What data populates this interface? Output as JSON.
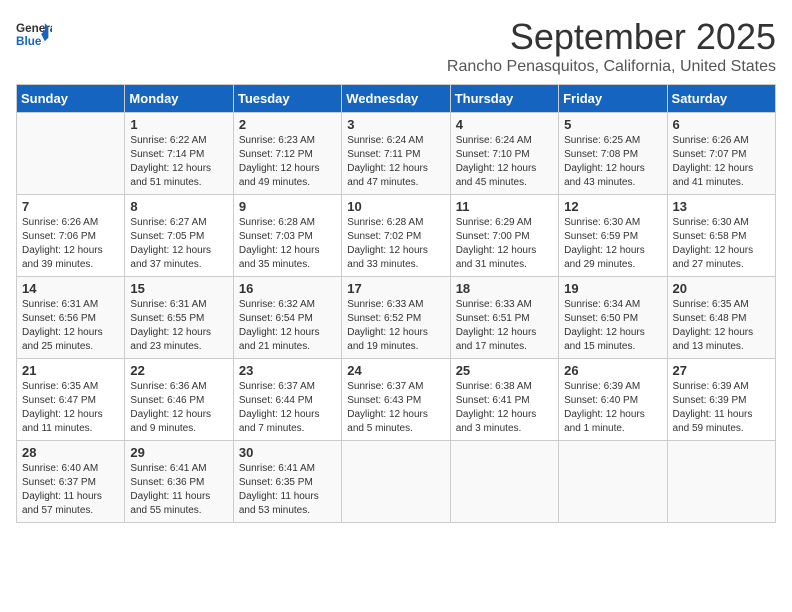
{
  "logo": {
    "line1": "General",
    "line2": "Blue"
  },
  "title": "September 2025",
  "subtitle": "Rancho Penasquitos, California, United States",
  "weekdays": [
    "Sunday",
    "Monday",
    "Tuesday",
    "Wednesday",
    "Thursday",
    "Friday",
    "Saturday"
  ],
  "weeks": [
    [
      {
        "day": "",
        "info": ""
      },
      {
        "day": "1",
        "info": "Sunrise: 6:22 AM\nSunset: 7:14 PM\nDaylight: 12 hours\nand 51 minutes."
      },
      {
        "day": "2",
        "info": "Sunrise: 6:23 AM\nSunset: 7:12 PM\nDaylight: 12 hours\nand 49 minutes."
      },
      {
        "day": "3",
        "info": "Sunrise: 6:24 AM\nSunset: 7:11 PM\nDaylight: 12 hours\nand 47 minutes."
      },
      {
        "day": "4",
        "info": "Sunrise: 6:24 AM\nSunset: 7:10 PM\nDaylight: 12 hours\nand 45 minutes."
      },
      {
        "day": "5",
        "info": "Sunrise: 6:25 AM\nSunset: 7:08 PM\nDaylight: 12 hours\nand 43 minutes."
      },
      {
        "day": "6",
        "info": "Sunrise: 6:26 AM\nSunset: 7:07 PM\nDaylight: 12 hours\nand 41 minutes."
      }
    ],
    [
      {
        "day": "7",
        "info": "Sunrise: 6:26 AM\nSunset: 7:06 PM\nDaylight: 12 hours\nand 39 minutes."
      },
      {
        "day": "8",
        "info": "Sunrise: 6:27 AM\nSunset: 7:05 PM\nDaylight: 12 hours\nand 37 minutes."
      },
      {
        "day": "9",
        "info": "Sunrise: 6:28 AM\nSunset: 7:03 PM\nDaylight: 12 hours\nand 35 minutes."
      },
      {
        "day": "10",
        "info": "Sunrise: 6:28 AM\nSunset: 7:02 PM\nDaylight: 12 hours\nand 33 minutes."
      },
      {
        "day": "11",
        "info": "Sunrise: 6:29 AM\nSunset: 7:00 PM\nDaylight: 12 hours\nand 31 minutes."
      },
      {
        "day": "12",
        "info": "Sunrise: 6:30 AM\nSunset: 6:59 PM\nDaylight: 12 hours\nand 29 minutes."
      },
      {
        "day": "13",
        "info": "Sunrise: 6:30 AM\nSunset: 6:58 PM\nDaylight: 12 hours\nand 27 minutes."
      }
    ],
    [
      {
        "day": "14",
        "info": "Sunrise: 6:31 AM\nSunset: 6:56 PM\nDaylight: 12 hours\nand 25 minutes."
      },
      {
        "day": "15",
        "info": "Sunrise: 6:31 AM\nSunset: 6:55 PM\nDaylight: 12 hours\nand 23 minutes."
      },
      {
        "day": "16",
        "info": "Sunrise: 6:32 AM\nSunset: 6:54 PM\nDaylight: 12 hours\nand 21 minutes."
      },
      {
        "day": "17",
        "info": "Sunrise: 6:33 AM\nSunset: 6:52 PM\nDaylight: 12 hours\nand 19 minutes."
      },
      {
        "day": "18",
        "info": "Sunrise: 6:33 AM\nSunset: 6:51 PM\nDaylight: 12 hours\nand 17 minutes."
      },
      {
        "day": "19",
        "info": "Sunrise: 6:34 AM\nSunset: 6:50 PM\nDaylight: 12 hours\nand 15 minutes."
      },
      {
        "day": "20",
        "info": "Sunrise: 6:35 AM\nSunset: 6:48 PM\nDaylight: 12 hours\nand 13 minutes."
      }
    ],
    [
      {
        "day": "21",
        "info": "Sunrise: 6:35 AM\nSunset: 6:47 PM\nDaylight: 12 hours\nand 11 minutes."
      },
      {
        "day": "22",
        "info": "Sunrise: 6:36 AM\nSunset: 6:46 PM\nDaylight: 12 hours\nand 9 minutes."
      },
      {
        "day": "23",
        "info": "Sunrise: 6:37 AM\nSunset: 6:44 PM\nDaylight: 12 hours\nand 7 minutes."
      },
      {
        "day": "24",
        "info": "Sunrise: 6:37 AM\nSunset: 6:43 PM\nDaylight: 12 hours\nand 5 minutes."
      },
      {
        "day": "25",
        "info": "Sunrise: 6:38 AM\nSunset: 6:41 PM\nDaylight: 12 hours\nand 3 minutes."
      },
      {
        "day": "26",
        "info": "Sunrise: 6:39 AM\nSunset: 6:40 PM\nDaylight: 12 hours\nand 1 minute."
      },
      {
        "day": "27",
        "info": "Sunrise: 6:39 AM\nSunset: 6:39 PM\nDaylight: 11 hours\nand 59 minutes."
      }
    ],
    [
      {
        "day": "28",
        "info": "Sunrise: 6:40 AM\nSunset: 6:37 PM\nDaylight: 11 hours\nand 57 minutes."
      },
      {
        "day": "29",
        "info": "Sunrise: 6:41 AM\nSunset: 6:36 PM\nDaylight: 11 hours\nand 55 minutes."
      },
      {
        "day": "30",
        "info": "Sunrise: 6:41 AM\nSunset: 6:35 PM\nDaylight: 11 hours\nand 53 minutes."
      },
      {
        "day": "",
        "info": ""
      },
      {
        "day": "",
        "info": ""
      },
      {
        "day": "",
        "info": ""
      },
      {
        "day": "",
        "info": ""
      }
    ]
  ]
}
